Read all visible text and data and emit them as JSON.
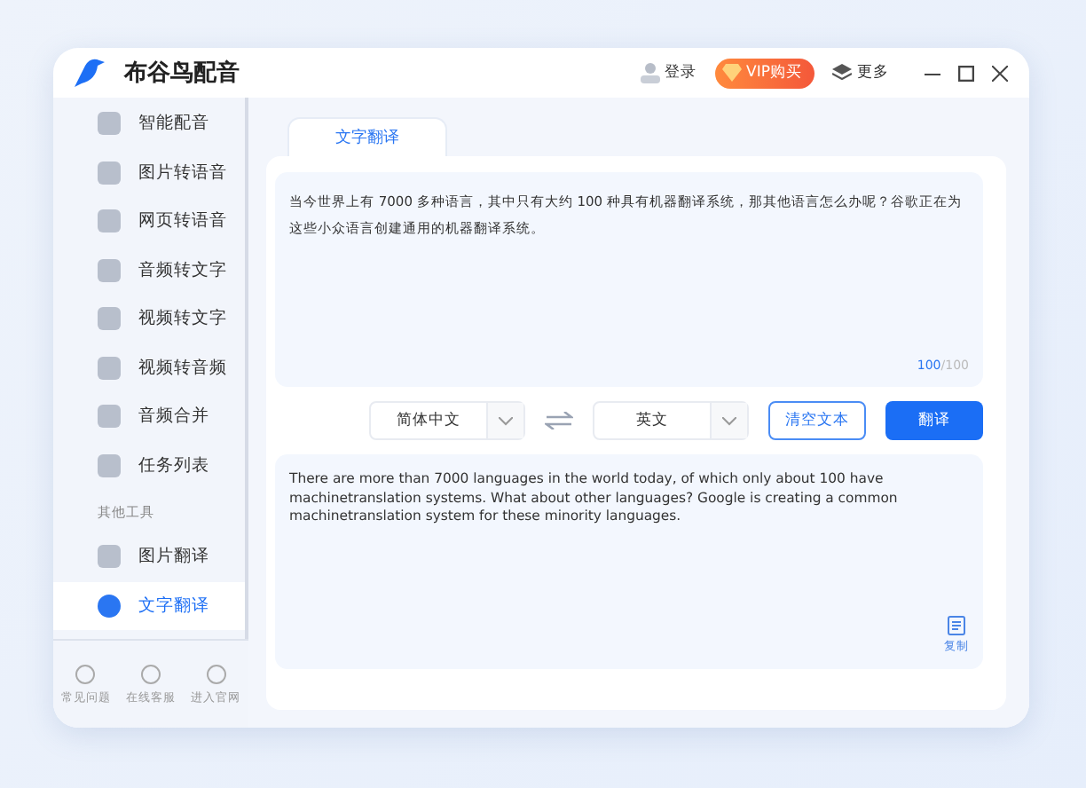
{
  "window": {
    "title": "布谷鸟配音",
    "login": "登录",
    "vip": "VIP购买",
    "more": "更多"
  },
  "sidebar": {
    "items": [
      {
        "kind": "item",
        "label": "智能配音",
        "selected": false
      },
      {
        "kind": "item",
        "label": "图片转语音",
        "selected": false
      },
      {
        "kind": "item",
        "label": "网页转语音",
        "selected": false
      },
      {
        "kind": "item",
        "label": "音频转文字",
        "selected": false
      },
      {
        "kind": "item",
        "label": "视频转文字",
        "selected": false
      },
      {
        "kind": "item",
        "label": "视频转音频",
        "selected": false
      },
      {
        "kind": "item",
        "label": "音频合并",
        "selected": false
      },
      {
        "kind": "item",
        "label": "任务列表",
        "selected": false
      },
      {
        "kind": "section",
        "label": "其他工具"
      },
      {
        "kind": "item",
        "label": "图片翻译",
        "selected": false
      },
      {
        "kind": "item",
        "label": "文字翻译",
        "selected": true
      }
    ],
    "footer": [
      "常见问题",
      "在线客服",
      "进入官网"
    ]
  },
  "tabs": [
    {
      "label": "文字翻译",
      "selected": true
    }
  ],
  "source": {
    "text": "当今世界上有 7000 多种语言，其中只有大约 100 种具有机器翻译系统，那其他语言怎么办呢？谷歌正在为这些小众语言创建通用的机器翻译系统。",
    "count": "100",
    "max": "/100"
  },
  "controls": {
    "from": "简体中文",
    "to": "英文",
    "clear": "清空文本",
    "translate": "翻译"
  },
  "result": {
    "text": "There are more than 7000 languages in the world today, of which only about 100 have machinetranslation systems. What about other languages? Google is creating a common machinetranslation system for these minority languages.",
    "copy": "复制"
  }
}
